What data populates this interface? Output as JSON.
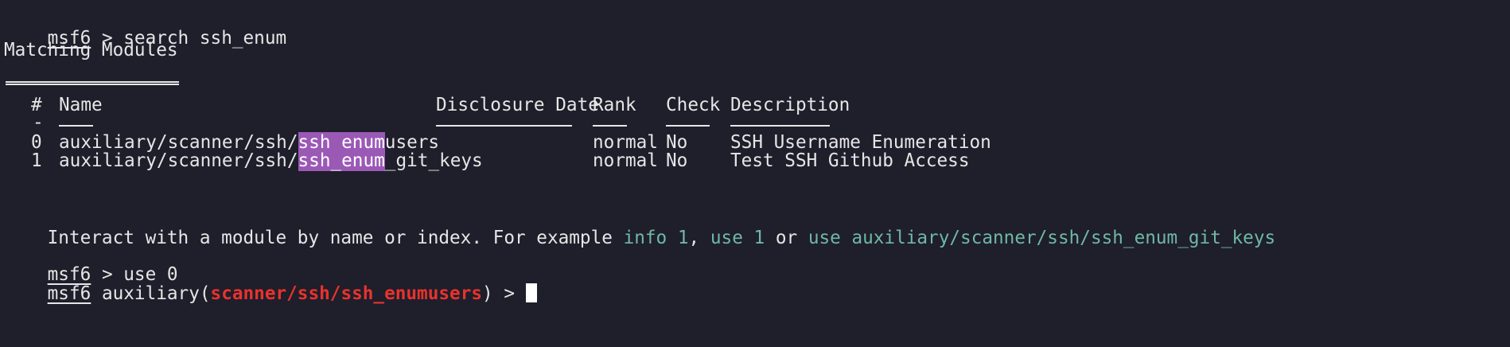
{
  "prompt": "msf6",
  "cmd1": " > search ssh_enum",
  "matching_title": "Matching Modules",
  "table": {
    "headers": {
      "num": "#",
      "name": "Name",
      "date": "Disclosure Date",
      "rank": "Rank",
      "check": "Check",
      "desc": "Description"
    },
    "dash": "-",
    "rows": [
      {
        "num": "0",
        "name_prefix": "auxiliary/scanner/ssh/",
        "name_match": "ssh_enum",
        "name_suffix": "users",
        "rank": "normal",
        "check": "No",
        "desc": "SSH Username Enumeration"
      },
      {
        "num": "1",
        "name_prefix": "auxiliary/scanner/ssh/",
        "name_match": "ssh_enum",
        "name_suffix": "_git_keys",
        "rank": "normal",
        "check": "No",
        "desc": "Test SSH Github Access"
      }
    ]
  },
  "interact": {
    "text1": "Interact with a module by name or index. For example ",
    "ex1": "info 1",
    "sep1": ", ",
    "ex2": "use 1",
    "sep2": " or ",
    "ex3": "use auxiliary/scanner/ssh/ssh_enum_git_keys"
  },
  "cmd2": " > use 0",
  "current": {
    "before": " auxiliary(",
    "module": "scanner/ssh/ssh_enumusers",
    "after": ") > "
  },
  "colors": {
    "background": "#1f1e2b",
    "text": "#e6e6e6",
    "highlight": "#9b59b6",
    "example": "#6fb8a5",
    "module_red": "#e8332c"
  }
}
